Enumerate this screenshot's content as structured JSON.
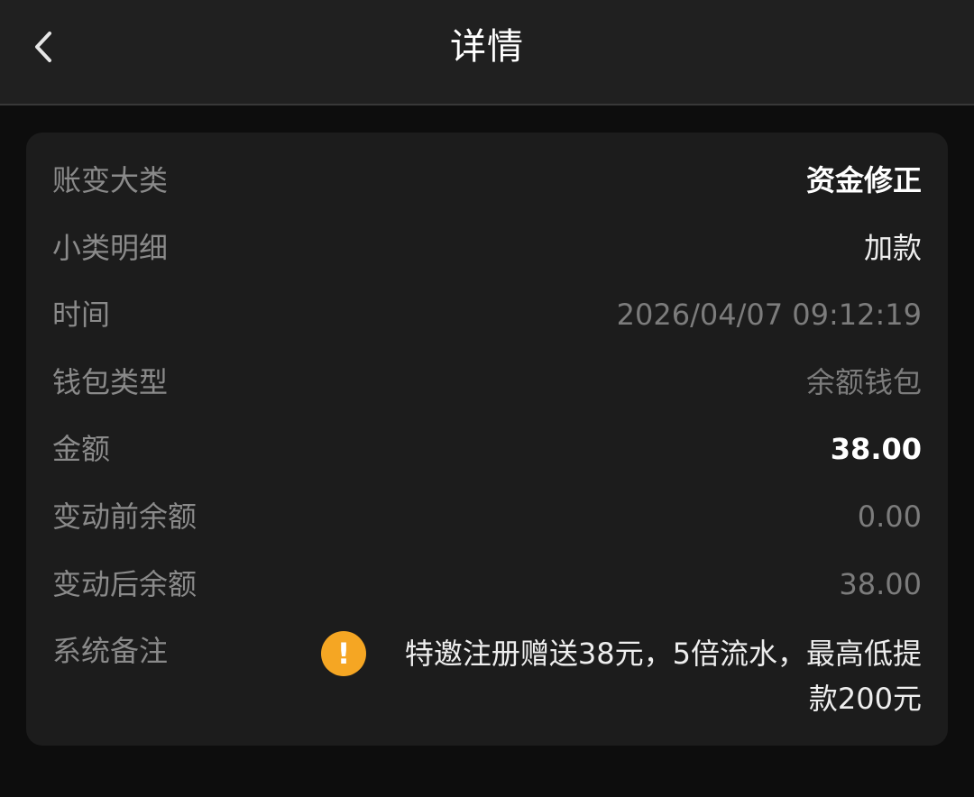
{
  "header": {
    "title": "详情",
    "back_icon": "chevron-left-icon"
  },
  "details": {
    "category": {
      "label": "账变大类",
      "value": "资金修正"
    },
    "subcategory": {
      "label": "小类明细",
      "value": "加款"
    },
    "time": {
      "label": "时间",
      "value": "2026/04/07 09:12:19"
    },
    "wallet_type": {
      "label": "钱包类型",
      "value": "余额钱包"
    },
    "amount": {
      "label": "金额",
      "value": "38.00"
    },
    "balance_before": {
      "label": "变动前余额",
      "value": "0.00"
    },
    "balance_after": {
      "label": "变动后余额",
      "value": "38.00"
    },
    "remark": {
      "label": "系统备注",
      "icon": "warning-icon",
      "icon_glyph": "!",
      "icon_color": "#f5a623",
      "value": "特邀注册赠送38元，5倍流水，最高低提款200元"
    }
  }
}
